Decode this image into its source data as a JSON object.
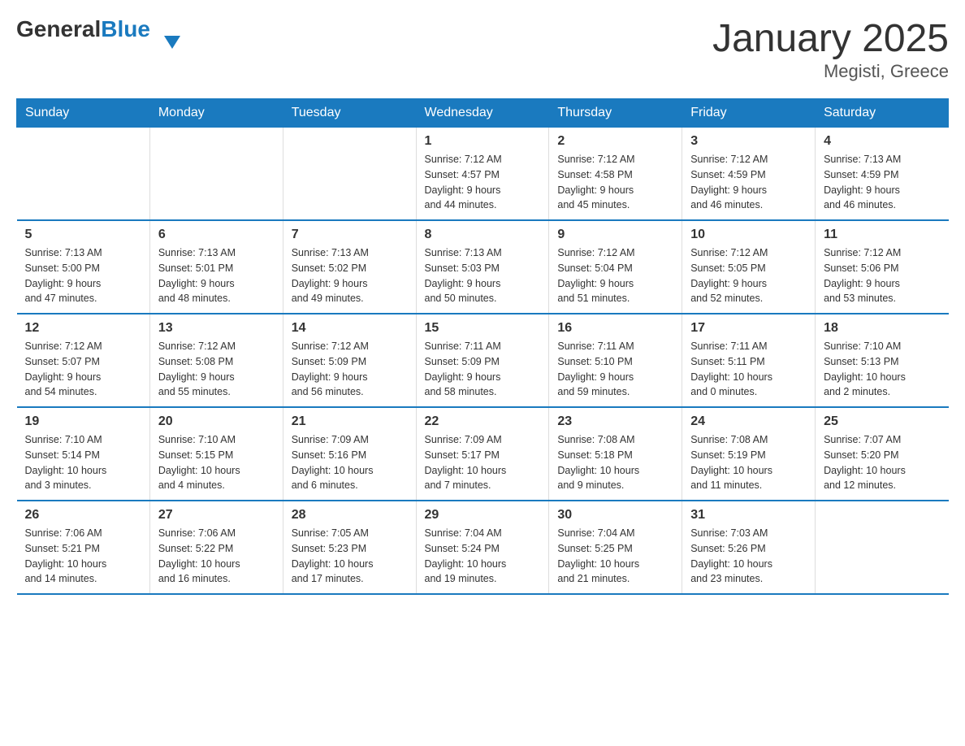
{
  "logo": {
    "general": "General",
    "blue": "Blue"
  },
  "title": "January 2025",
  "subtitle": "Megisti, Greece",
  "days_of_week": [
    "Sunday",
    "Monday",
    "Tuesday",
    "Wednesday",
    "Thursday",
    "Friday",
    "Saturday"
  ],
  "weeks": [
    [
      {
        "day": "",
        "info": ""
      },
      {
        "day": "",
        "info": ""
      },
      {
        "day": "",
        "info": ""
      },
      {
        "day": "1",
        "info": "Sunrise: 7:12 AM\nSunset: 4:57 PM\nDaylight: 9 hours\nand 44 minutes."
      },
      {
        "day": "2",
        "info": "Sunrise: 7:12 AM\nSunset: 4:58 PM\nDaylight: 9 hours\nand 45 minutes."
      },
      {
        "day": "3",
        "info": "Sunrise: 7:12 AM\nSunset: 4:59 PM\nDaylight: 9 hours\nand 46 minutes."
      },
      {
        "day": "4",
        "info": "Sunrise: 7:13 AM\nSunset: 4:59 PM\nDaylight: 9 hours\nand 46 minutes."
      }
    ],
    [
      {
        "day": "5",
        "info": "Sunrise: 7:13 AM\nSunset: 5:00 PM\nDaylight: 9 hours\nand 47 minutes."
      },
      {
        "day": "6",
        "info": "Sunrise: 7:13 AM\nSunset: 5:01 PM\nDaylight: 9 hours\nand 48 minutes."
      },
      {
        "day": "7",
        "info": "Sunrise: 7:13 AM\nSunset: 5:02 PM\nDaylight: 9 hours\nand 49 minutes."
      },
      {
        "day": "8",
        "info": "Sunrise: 7:13 AM\nSunset: 5:03 PM\nDaylight: 9 hours\nand 50 minutes."
      },
      {
        "day": "9",
        "info": "Sunrise: 7:12 AM\nSunset: 5:04 PM\nDaylight: 9 hours\nand 51 minutes."
      },
      {
        "day": "10",
        "info": "Sunrise: 7:12 AM\nSunset: 5:05 PM\nDaylight: 9 hours\nand 52 minutes."
      },
      {
        "day": "11",
        "info": "Sunrise: 7:12 AM\nSunset: 5:06 PM\nDaylight: 9 hours\nand 53 minutes."
      }
    ],
    [
      {
        "day": "12",
        "info": "Sunrise: 7:12 AM\nSunset: 5:07 PM\nDaylight: 9 hours\nand 54 minutes."
      },
      {
        "day": "13",
        "info": "Sunrise: 7:12 AM\nSunset: 5:08 PM\nDaylight: 9 hours\nand 55 minutes."
      },
      {
        "day": "14",
        "info": "Sunrise: 7:12 AM\nSunset: 5:09 PM\nDaylight: 9 hours\nand 56 minutes."
      },
      {
        "day": "15",
        "info": "Sunrise: 7:11 AM\nSunset: 5:09 PM\nDaylight: 9 hours\nand 58 minutes."
      },
      {
        "day": "16",
        "info": "Sunrise: 7:11 AM\nSunset: 5:10 PM\nDaylight: 9 hours\nand 59 minutes."
      },
      {
        "day": "17",
        "info": "Sunrise: 7:11 AM\nSunset: 5:11 PM\nDaylight: 10 hours\nand 0 minutes."
      },
      {
        "day": "18",
        "info": "Sunrise: 7:10 AM\nSunset: 5:13 PM\nDaylight: 10 hours\nand 2 minutes."
      }
    ],
    [
      {
        "day": "19",
        "info": "Sunrise: 7:10 AM\nSunset: 5:14 PM\nDaylight: 10 hours\nand 3 minutes."
      },
      {
        "day": "20",
        "info": "Sunrise: 7:10 AM\nSunset: 5:15 PM\nDaylight: 10 hours\nand 4 minutes."
      },
      {
        "day": "21",
        "info": "Sunrise: 7:09 AM\nSunset: 5:16 PM\nDaylight: 10 hours\nand 6 minutes."
      },
      {
        "day": "22",
        "info": "Sunrise: 7:09 AM\nSunset: 5:17 PM\nDaylight: 10 hours\nand 7 minutes."
      },
      {
        "day": "23",
        "info": "Sunrise: 7:08 AM\nSunset: 5:18 PM\nDaylight: 10 hours\nand 9 minutes."
      },
      {
        "day": "24",
        "info": "Sunrise: 7:08 AM\nSunset: 5:19 PM\nDaylight: 10 hours\nand 11 minutes."
      },
      {
        "day": "25",
        "info": "Sunrise: 7:07 AM\nSunset: 5:20 PM\nDaylight: 10 hours\nand 12 minutes."
      }
    ],
    [
      {
        "day": "26",
        "info": "Sunrise: 7:06 AM\nSunset: 5:21 PM\nDaylight: 10 hours\nand 14 minutes."
      },
      {
        "day": "27",
        "info": "Sunrise: 7:06 AM\nSunset: 5:22 PM\nDaylight: 10 hours\nand 16 minutes."
      },
      {
        "day": "28",
        "info": "Sunrise: 7:05 AM\nSunset: 5:23 PM\nDaylight: 10 hours\nand 17 minutes."
      },
      {
        "day": "29",
        "info": "Sunrise: 7:04 AM\nSunset: 5:24 PM\nDaylight: 10 hours\nand 19 minutes."
      },
      {
        "day": "30",
        "info": "Sunrise: 7:04 AM\nSunset: 5:25 PM\nDaylight: 10 hours\nand 21 minutes."
      },
      {
        "day": "31",
        "info": "Sunrise: 7:03 AM\nSunset: 5:26 PM\nDaylight: 10 hours\nand 23 minutes."
      },
      {
        "day": "",
        "info": ""
      }
    ]
  ]
}
